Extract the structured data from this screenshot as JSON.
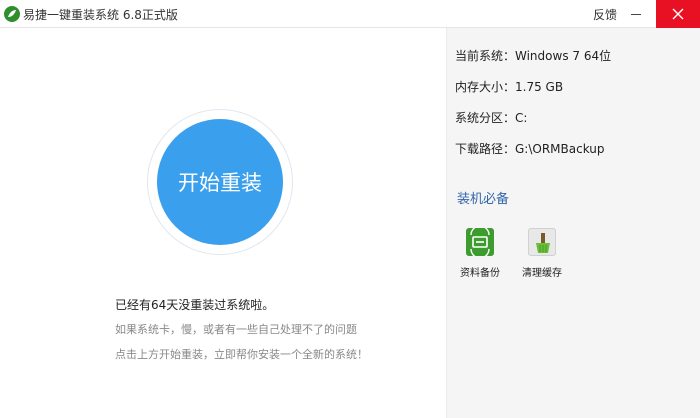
{
  "window": {
    "title": "易捷一键重装系统 6.8正式版",
    "feedback": "反馈",
    "close_color": "#e81123"
  },
  "main": {
    "reinstall_button": "开始重装",
    "button_color": "#3aa0ee",
    "days_message": "已经有64天没重装过系统啦。",
    "tips": [
      "如果系统卡，慢，或者有一些自己处理不了的问题",
      "点击上方开始重装，立即帮你安装一个全新的系统！"
    ]
  },
  "system_info": {
    "current_system": "当前系统：Windows 7 64位",
    "memory": "内存大小：1.75 GB",
    "partition": "系统分区：C:",
    "download_path": "下载路径：G:\\ORMBackup"
  },
  "essentials": {
    "title": "装机必备",
    "tools": [
      {
        "label": "资料备份",
        "icon": "backup-icon",
        "color": "#3c9c2e"
      },
      {
        "label": "清理缓存",
        "icon": "clean-cache-icon",
        "color": "#e8e8e8"
      }
    ]
  }
}
